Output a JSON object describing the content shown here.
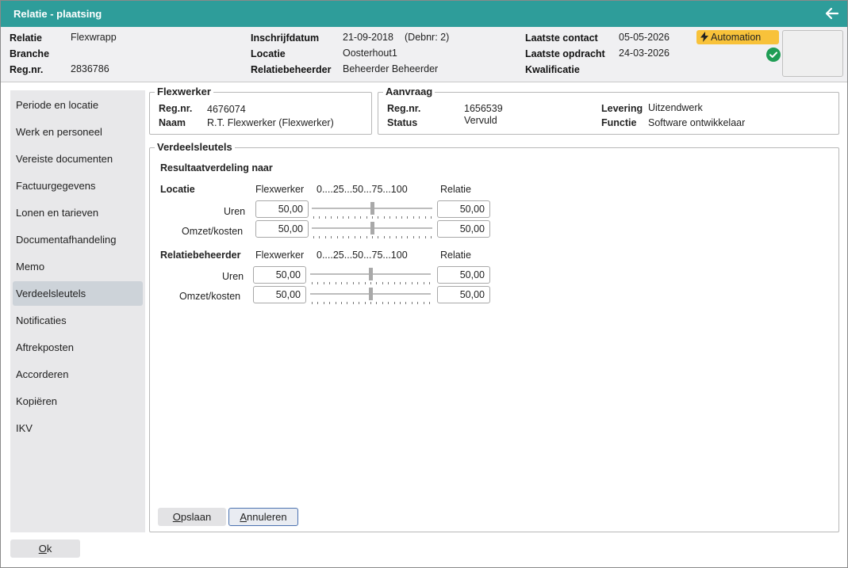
{
  "window": {
    "title": "Relatie - plaatsing"
  },
  "header": {
    "col1": [
      {
        "label": "Relatie",
        "value": "Flexwrapp"
      },
      {
        "label": "Branche",
        "value": ""
      },
      {
        "label": "Reg.nr.",
        "value": "2836786"
      }
    ],
    "col2": [
      {
        "label": "Inschrijfdatum",
        "value": "21-09-2018",
        "extra": "(Debnr: 2)"
      },
      {
        "label": "Locatie",
        "value": "Oosterhout1"
      },
      {
        "label": "Relatiebeheerder",
        "value": "Beheerder Beheerder"
      }
    ],
    "col3": [
      {
        "label": "Laatste contact",
        "value": "05-05-2026"
      },
      {
        "label": "Laatste opdracht",
        "value": "24-03-2026"
      },
      {
        "label": "Kwalificatie",
        "value": ""
      }
    ],
    "automation_label": "Automation",
    "automation_color": "#f8c23a",
    "status_color": "#1f9d55"
  },
  "sidebar": {
    "items": [
      {
        "label": "Periode en locatie"
      },
      {
        "label": "Werk en personeel"
      },
      {
        "label": "Vereiste documenten"
      },
      {
        "label": "Factuurgegevens"
      },
      {
        "label": "Lonen en tarieven"
      },
      {
        "label": "Documentafhandeling"
      },
      {
        "label": "Memo"
      },
      {
        "label": "Verdeelsleutels",
        "active": true
      },
      {
        "label": "Notificaties"
      },
      {
        "label": "Aftrekposten"
      },
      {
        "label": "Accorderen"
      },
      {
        "label": "Kopiëren"
      },
      {
        "label": "IKV"
      }
    ]
  },
  "flexwerker": {
    "legend": "Flexwerker",
    "regnr_label": "Reg.nr.",
    "regnr": "4676074",
    "naam_label": "Naam",
    "naam": "R.T. Flexwerker (Flexwerker)"
  },
  "aanvraag": {
    "legend": "Aanvraag",
    "regnr_label": "Reg.nr.",
    "regnr": "1656539",
    "status_label": "Status",
    "status": "Vervuld",
    "levering_label": "Levering",
    "levering": "Uitzendwerk",
    "functie_label": "Functie",
    "functie": "Software ontwikkelaar"
  },
  "verdeelsleutels": {
    "legend": "Verdeelsleutels",
    "subtitle": "Resultaatverdeling naar",
    "sections": [
      {
        "title": "Locatie",
        "col_flex": "Flexwerker",
        "scale": "0....25...50...75...100",
        "col_rel": "Relatie",
        "rows": [
          {
            "label": "Uren",
            "flex": "50,00",
            "rel": "50,00",
            "percent": 50
          },
          {
            "label": "Omzet/kosten",
            "flex": "50,00",
            "rel": "50,00",
            "percent": 50
          }
        ]
      },
      {
        "title": "Relatiebeheerder",
        "col_flex": "Flexwerker",
        "scale": "0....25...50...75...100",
        "col_rel": "Relatie",
        "rows": [
          {
            "label": "Uren",
            "flex": "50,00",
            "rel": "50,00",
            "percent": 50
          },
          {
            "label": "Omzet/kosten",
            "flex": "50,00",
            "rel": "50,00",
            "percent": 50
          }
        ]
      }
    ]
  },
  "buttons": {
    "save_key": "O",
    "save_rest": "pslaan",
    "cancel_key": "A",
    "cancel_rest": "nnuleren",
    "ok_key": "O",
    "ok_rest": "k"
  }
}
